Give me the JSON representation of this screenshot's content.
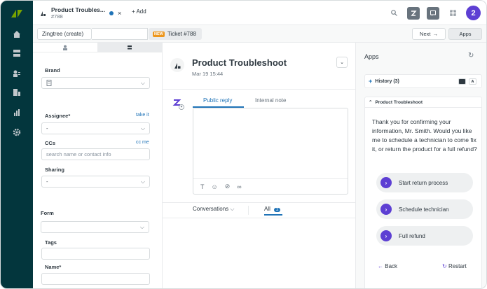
{
  "window": {
    "tab_title": "Product Troubles...",
    "tab_subtitle": "#788",
    "add_label": "+ Add"
  },
  "topbar": {
    "avatar_letter": "2"
  },
  "breadcrumb": {
    "item1": "Zingtree (create)",
    "badge": "NEW",
    "item2": "Ticket #788",
    "next_label": "Next",
    "apps_label": "Apps"
  },
  "properties": {
    "brand_label": "Brand",
    "assignee_label": "Assignee*",
    "take_it": "take it",
    "assignee_value": "-",
    "ccs_label": "CCs",
    "cc_me": "cc me",
    "ccs_placeholder": "search name or contact info",
    "sharing_label": "Sharing",
    "sharing_value": "-",
    "form_label": "Form",
    "tags_label": "Tags",
    "name_label": "Name*"
  },
  "conversation": {
    "subject": "Product Troubleshoot",
    "date": "Mar 19 15:44",
    "reply_tab": "Public reply",
    "note_tab": "Internal note",
    "conversations_tab": "Conversations",
    "all_tab": "All",
    "all_count": "2"
  },
  "apps": {
    "title": "Apps",
    "history": "History (3)",
    "history_badge": "A",
    "app_name": "Product Troubleshoot",
    "message": "Thank you for confirming your information, Mr. Smith. Would you like me to schedule a technician to come fix it, or return the product for a full refund?",
    "options": [
      "Start return process",
      "Schedule technician",
      "Full refund"
    ],
    "back": "Back",
    "restart": "Restart"
  },
  "colors": {
    "accent": "#1f73b7",
    "rail": "#03363d",
    "app_purple": "#5d3fd3",
    "new_badge": "#ed961c"
  }
}
